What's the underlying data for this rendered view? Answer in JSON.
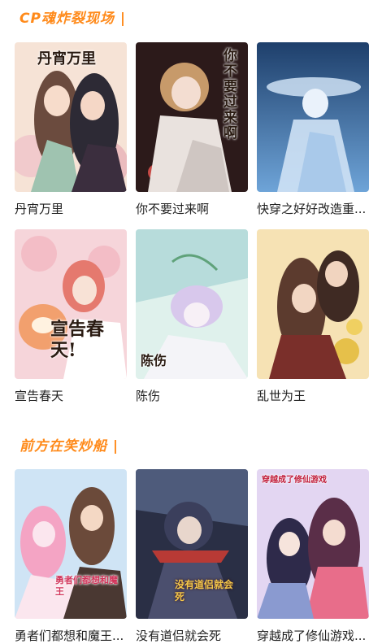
{
  "sections": [
    {
      "title": "CP魂炸裂现场 |",
      "items": [
        {
          "label": "丹宵万里",
          "cover_text": "丹宵万里",
          "palette": [
            "#f2d9c8",
            "#6b4b3e",
            "#e8b2b8"
          ]
        },
        {
          "label": "你不要过来啊",
          "cover_text": "你不要过来啊",
          "palette": [
            "#2c1a1a",
            "#e9e2de",
            "#c74a46"
          ]
        },
        {
          "label": "快穿之好好改造重...",
          "cover_text": "",
          "palette": [
            "#4a7fb8",
            "#cfe2f5",
            "#1e3f6b"
          ]
        }
      ]
    },
    {
      "title": "",
      "items": [
        {
          "label": "宣告春天",
          "cover_text": "宣告春天!",
          "palette": [
            "#f6c9cf",
            "#f2a06e",
            "#d86e6e"
          ]
        },
        {
          "label": "陈伤",
          "cover_text": "陈伤",
          "palette": [
            "#d8ece8",
            "#9dcfd0",
            "#b9a2d6"
          ]
        },
        {
          "label": "乱世为王",
          "cover_text": "",
          "palette": [
            "#f6d89a",
            "#5c3b2e",
            "#e6c04a"
          ]
        }
      ]
    },
    {
      "title": "前方在笑炒船 |",
      "items": [
        {
          "label": "勇者们都想和魔王...",
          "cover_text": "勇者们都想和魔王",
          "palette": [
            "#b9d7f0",
            "#f4a4c4",
            "#6b4a3a"
          ]
        },
        {
          "label": "没有道侣就会死",
          "cover_text": "没有道侣就会死",
          "palette": [
            "#2a2f45",
            "#b83a35",
            "#6b7fa8"
          ]
        },
        {
          "label": "穿越成了修仙游戏...",
          "cover_text": "穿越成了修仙游戏",
          "palette": [
            "#c9b6e6",
            "#5a2e48",
            "#e86d8a"
          ]
        }
      ]
    }
  ]
}
